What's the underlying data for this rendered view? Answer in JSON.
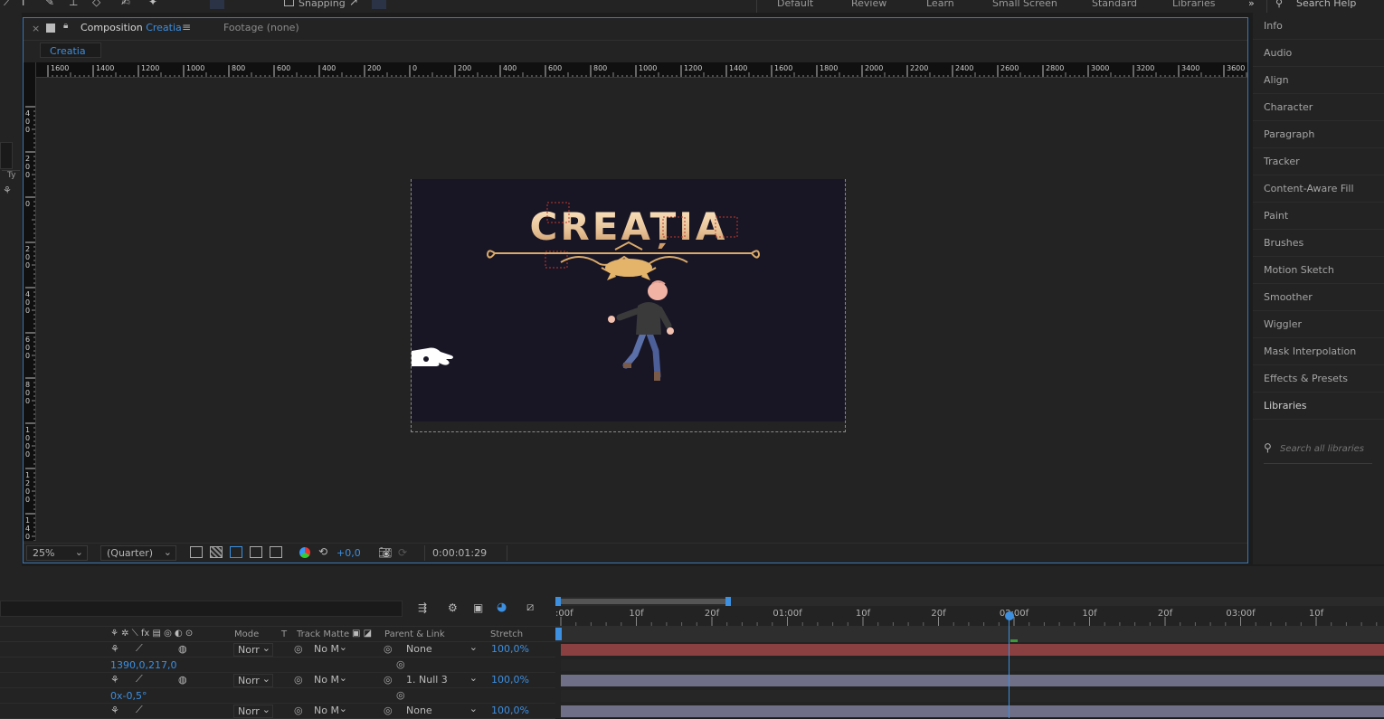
{
  "toolbar": {
    "snapping_label": "Snapping",
    "workspaces": [
      "Default",
      "Review",
      "Learn",
      "Small Screen",
      "Standard",
      "Libraries"
    ],
    "overflow": "»",
    "search_help": "Search Help"
  },
  "composition_panel": {
    "tab_prefix": "Composition",
    "comp_name": "Creatia",
    "footage_tab": "Footage (none)",
    "subtab": "Creatia",
    "ruler_labels": [
      "1600",
      "1400",
      "1200",
      "1000",
      "800",
      "600",
      "400",
      "200",
      "0",
      "200",
      "400",
      "600",
      "800",
      "1000",
      "1200",
      "1400",
      "1600",
      "1800",
      "2000",
      "2200",
      "2400",
      "2600",
      "2800",
      "3000",
      "3200",
      "3400",
      "3600"
    ],
    "vruler_labels": [
      "400",
      "200",
      "0",
      "200",
      "400",
      "600",
      "800",
      "1000",
      "1200",
      "1400"
    ],
    "artwork_title": "CREAȚIA",
    "zoom": "25%",
    "resolution": "(Quarter)",
    "exposure": "+0,0",
    "timecode": "0:00:01:29"
  },
  "right_panel": {
    "items": [
      "Info",
      "Audio",
      "Align",
      "Character",
      "Paragraph",
      "Tracker",
      "Content-Aware Fill",
      "Paint",
      "Brushes",
      "Motion Sketch",
      "Smoother",
      "Wiggler",
      "Mask Interpolation",
      "Effects & Presets",
      "Libraries"
    ],
    "search_placeholder": "Search all libraries"
  },
  "timeline": {
    "columns": {
      "mode": "Mode",
      "t": "T",
      "track_matte": "Track Matte",
      "parent": "Parent & Link",
      "stretch": "Stretch"
    },
    "ruler_labels": [
      ":00f",
      "10f",
      "20f",
      "01:00f",
      "10f",
      "20f",
      "02:00f",
      "10f",
      "20f",
      "03:00f",
      "10f"
    ],
    "rows": [
      {
        "mode": "Norr",
        "matte": "No M",
        "parent": "None",
        "stretch": "100,0%",
        "color": "#8a4040"
      },
      {
        "sub": "1390,0,217,0"
      },
      {
        "mode": "Norr",
        "matte": "No M",
        "parent": "1. Null 3",
        "stretch": "100,0%",
        "color": "#6f6f88"
      },
      {
        "sub": "0x-0,5°"
      },
      {
        "mode": "Norr",
        "matte": "No M",
        "parent": "None",
        "stretch": "100,0%",
        "color": "#6f6f88"
      }
    ]
  },
  "colors": {
    "accent": "#3d8fe0",
    "comp_bg": "#181525",
    "title_gold": "#e8c49a"
  }
}
